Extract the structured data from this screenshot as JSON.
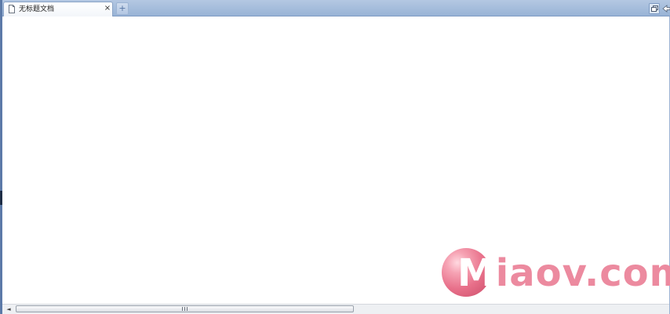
{
  "tabbar": {
    "tabs": [
      {
        "label": "无标题文档",
        "icon": "document-icon",
        "close_label": "×",
        "active": true
      }
    ],
    "new_tab_label": "+",
    "right_buttons": [
      {
        "icon": "restore-window-icon"
      },
      {
        "icon": "back-arrow-icon"
      }
    ]
  },
  "content": {},
  "scrollbar": {
    "left_arrow": "◄"
  },
  "watermark": {
    "first_letter": "M",
    "rest": "iaov.com",
    "colors": {
      "ball": "#e8708a",
      "text": "#ec8a9f"
    }
  },
  "colors": {
    "tabbar": "#a9c0de",
    "border": "#5c7aa8",
    "content": "#ffffff"
  }
}
